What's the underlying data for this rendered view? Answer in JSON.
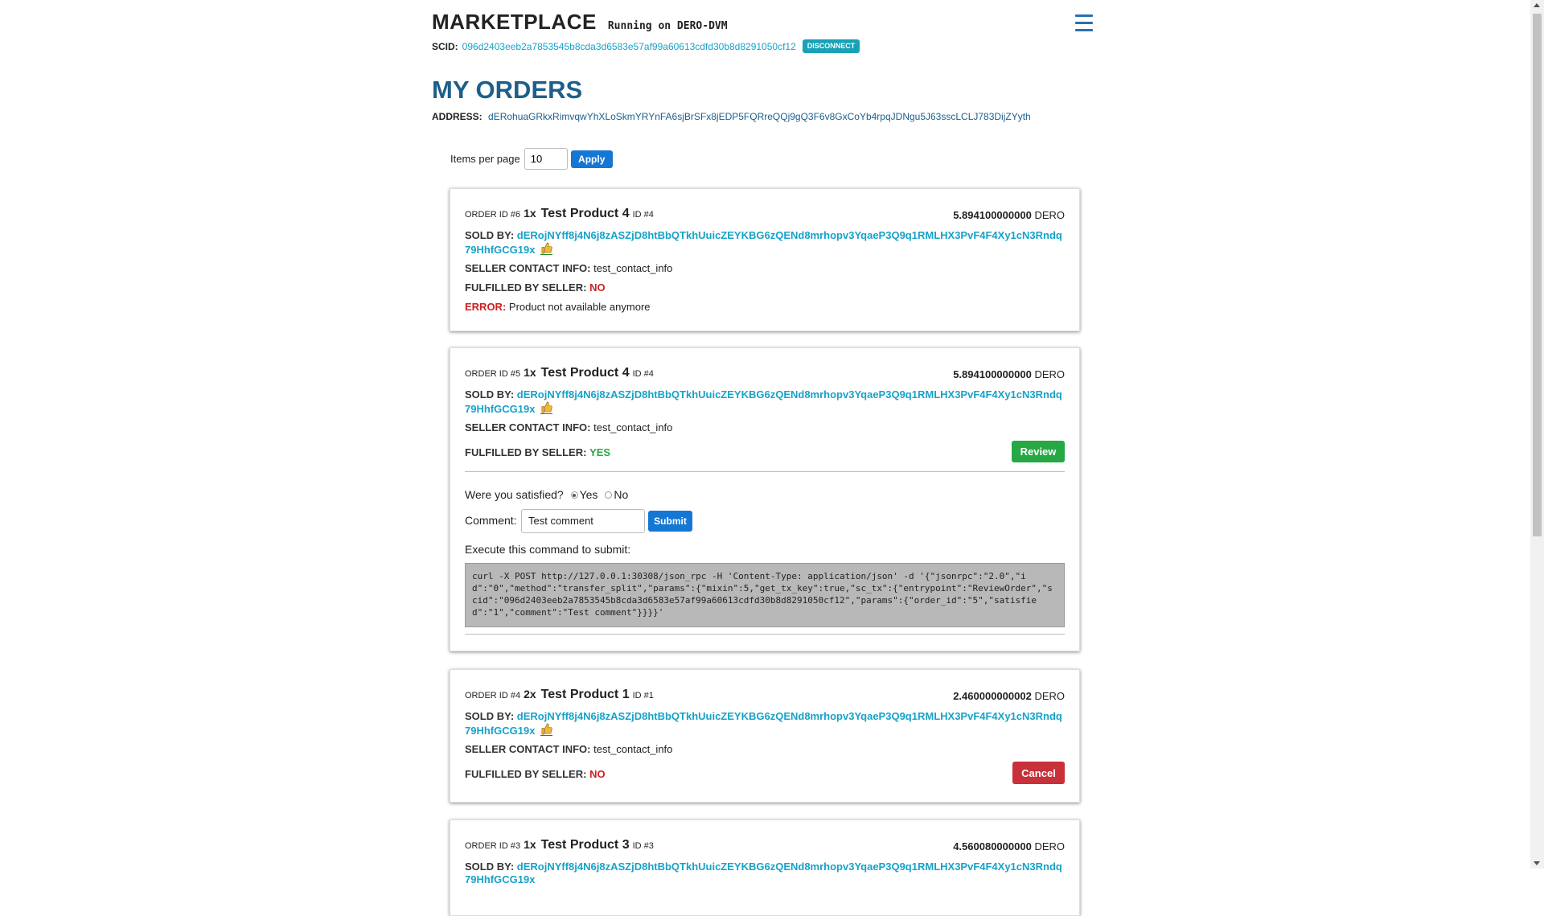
{
  "header": {
    "brand": "MARKETPLACE",
    "running": "Running on DERO-DVM",
    "scid_label": "SCID:",
    "scid": "096d2403eeb2a7853545b8cda3d6583e57af99a60613cdfd30b8d8291050cf12",
    "disconnect_label": "DISCONNECT"
  },
  "page": {
    "title": "MY ORDERS",
    "address_label": "ADDRESS:",
    "address": "dERohuaGRkxRimvqwYhXLoSkmYRYnFA6sjBrSFx8jEDP5FQRreQQj9gQ3F6v8GxCoYb4rpqJDNgu5J63sscLCLJ783DijZYyth"
  },
  "pager": {
    "label": "Items per page",
    "value": "10",
    "apply_label": "Apply"
  },
  "labels": {
    "sold_by": "SOLD BY:",
    "contact": "SELLER CONTACT INFO:",
    "fulfilled": "FULFILLED BY SELLER:",
    "error": "ERROR:",
    "satisfied_q": "Were you satisfied?",
    "yes": "Yes",
    "no": "No",
    "comment": "Comment:",
    "submit": "Submit",
    "execute": "Execute this command to submit:",
    "review": "Review",
    "cancel": "Cancel"
  },
  "orders": [
    {
      "order_id": "ORDER ID #6",
      "qty": "1x",
      "product": "Test Product 4",
      "product_id": "ID #4",
      "price": "5.894100000000",
      "currency": "DERO",
      "seller": "dERojNYff8j4N6j8zASZjD8htBbQTkhUuicZEYKBG6zQENd8mrhopv3YqaeP3Q9q1RMLHX3PvF4F4Xy1cN3Rndq79HhfGCG19x",
      "contact": "test_contact_info",
      "fulfilled": "NO",
      "error": "Product not available anymore"
    },
    {
      "order_id": "ORDER ID #5",
      "qty": "1x",
      "product": "Test Product 4",
      "product_id": "ID #4",
      "price": "5.894100000000",
      "currency": "DERO",
      "seller": "dERojNYff8j4N6j8zASZjD8htBbQTkhUuicZEYKBG6zQENd8mrhopv3YqaeP3Q9q1RMLHX3PvF4F4Xy1cN3Rndq79HhfGCG19x",
      "contact": "test_contact_info",
      "fulfilled": "YES",
      "comment_value": "Test comment",
      "command": "curl -X POST http://127.0.0.1:30308/json_rpc -H 'Content-Type: application/json' -d '{\"jsonrpc\":\"2.0\",\"id\":\"0\",\"method\":\"transfer_split\",\"params\":{\"mixin\":5,\"get_tx_key\":true,\"sc_tx\":{\"entrypoint\":\"ReviewOrder\",\"scid\":\"096d2403eeb2a7853545b8cda3d6583e57af99a60613cdfd30b8d8291050cf12\",\"params\":{\"order_id\":\"5\",\"satisfied\":\"1\",\"comment\":\"Test comment\"}}}}'"
    },
    {
      "order_id": "ORDER ID #4",
      "qty": "2x",
      "product": "Test Product 1",
      "product_id": "ID #1",
      "price": "2.460000000002",
      "currency": "DERO",
      "seller": "dERojNYff8j4N6j8zASZjD8htBbQTkhUuicZEYKBG6zQENd8mrhopv3YqaeP3Q9q1RMLHX3PvF4F4Xy1cN3Rndq79HhfGCG19x",
      "contact": "test_contact_info",
      "fulfilled": "NO"
    },
    {
      "order_id": "ORDER ID #3",
      "qty": "1x",
      "product": "Test Product 3",
      "product_id": "ID #3",
      "price": "4.560080000000",
      "currency": "DERO",
      "seller": "dERojNYff8j4N6j8zASZjD8htBbQTkhUuicZEYKBG6zQENd8mrhopv3YqaeP3Q9q1RMLHX3PvF4F4Xy1cN3Rndq79HhfGCG19x"
    }
  ],
  "colors": {
    "accent": "#17a2c8",
    "title": "#1d5f8a",
    "success": "#26a844",
    "danger": "#c8303a",
    "primary": "#1577d4"
  }
}
